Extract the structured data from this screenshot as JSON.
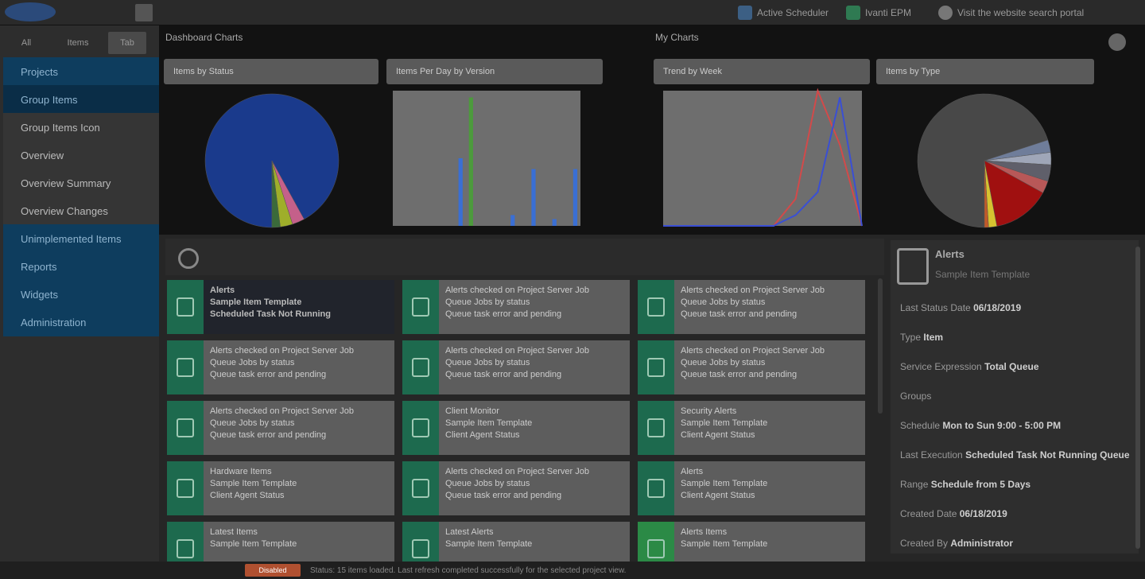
{
  "topbar": {
    "links": [
      {
        "label": "Active Scheduler",
        "icon": "calendar-icon"
      },
      {
        "label": "Ivanti EPM",
        "icon": "app-icon"
      },
      {
        "label": "Visit the website search portal",
        "icon": "user-icon"
      }
    ]
  },
  "left": {
    "tabs": [
      "All",
      "Items",
      "Tab"
    ],
    "nav": [
      {
        "label": "Projects",
        "style": "blue"
      },
      {
        "label": "Group Items",
        "style": "active"
      },
      {
        "label": "Group Items Icon",
        "style": "grey"
      },
      {
        "label": "Overview",
        "style": "grey"
      },
      {
        "label": "Overview Summary",
        "style": "grey"
      },
      {
        "label": "Overview Changes",
        "style": "grey"
      },
      {
        "label": "Unimplemented Items",
        "style": "blue"
      },
      {
        "label": "Reports",
        "style": "blue"
      },
      {
        "label": "Widgets",
        "style": "blue"
      },
      {
        "label": "Administration",
        "style": "blue"
      }
    ]
  },
  "strip": {
    "left_title": "Dashboard Charts",
    "right_title": "My Charts",
    "chart_heads": [
      "Items by Status",
      "Items Per Day by Version",
      "Trend by Week",
      "Items by Type"
    ]
  },
  "cards": [
    {
      "lines": [
        "Alerts",
        "Sample Item Template",
        "Scheduled Task Not Running"
      ],
      "selected": true
    },
    {
      "lines": [
        "Alerts checked on Project Server Job",
        "Queue Jobs by status",
        "Queue task error and pending"
      ]
    },
    {
      "lines": [
        "Alerts checked on Project Server Job",
        "Queue Jobs by status",
        "Queue task error and pending"
      ]
    },
    {
      "lines": [
        "Alerts checked on Project Server Job",
        "Queue Jobs by status",
        "Queue task error and pending"
      ]
    },
    {
      "lines": [
        "Alerts checked on Project Server Job",
        "Queue Jobs by status",
        "Queue task error and pending"
      ]
    },
    {
      "lines": [
        "Alerts checked on Project Server Job",
        "Queue Jobs by status",
        "Queue task error and pending"
      ]
    },
    {
      "lines": [
        "Alerts checked on Project Server Job",
        "Queue Jobs by status",
        "Queue task error and pending"
      ]
    },
    {
      "lines": [
        "Client Monitor",
        "Sample Item Template",
        "Client Agent Status"
      ]
    },
    {
      "lines": [
        "Security Alerts",
        "Sample Item Template",
        "Client Agent Status"
      ]
    },
    {
      "lines": [
        "Hardware Items",
        "Sample Item Template",
        "Client Agent Status"
      ]
    },
    {
      "lines": [
        "Alerts checked on Project Server Job",
        "Queue Jobs by status",
        "Queue task error and pending"
      ]
    },
    {
      "lines": [
        "Alerts",
        "Sample Item Template",
        "Client Agent Status"
      ]
    },
    {
      "lines": [
        "Latest Items",
        "Sample Item Template"
      ]
    },
    {
      "lines": [
        "Latest Alerts",
        "Sample Item Template"
      ]
    },
    {
      "lines": [
        "Alerts Items",
        "Sample Item Template"
      ],
      "bright": true
    }
  ],
  "details": {
    "title": "Alerts",
    "subtitle": "Sample Item Template",
    "props": [
      {
        "k": "Last Status Date",
        "v": "06/18/2019"
      },
      {
        "k": "Type",
        "v": "Item"
      },
      {
        "k": "Service Expression",
        "v": "Total Queue"
      },
      {
        "k": "Groups",
        "v": ""
      },
      {
        "k": "Schedule",
        "v": "Mon to Sun 9:00 - 5:00 PM"
      },
      {
        "k": "Last Execution",
        "v": "Scheduled Task Not Running Queue"
      },
      {
        "k": "Range",
        "v": "Schedule from 5 Days"
      },
      {
        "k": "Created Date",
        "v": "06/18/2019"
      },
      {
        "k": "Created By",
        "v": "Administrator"
      }
    ]
  },
  "status": {
    "badge": "Disabled",
    "text": "Status: 15 items loaded. Last refresh completed successfully for the selected project view."
  },
  "chart_data": [
    {
      "type": "pie",
      "title": "Items by Status",
      "values": [
        92,
        3,
        3,
        2
      ],
      "colors": [
        "#1a3a8c",
        "#c4608a",
        "#9fae2a",
        "#3a6a3a"
      ]
    },
    {
      "type": "bar",
      "title": "Items Per Day by Version",
      "categories": [
        "1",
        "2",
        "3",
        "4",
        "5",
        "6",
        "7",
        "8",
        "9",
        "10",
        "11",
        "12",
        "13",
        "14",
        "15",
        "16",
        "17",
        "18"
      ],
      "series": [
        {
          "values": [
            0,
            0,
            0,
            0,
            0,
            0,
            50,
            0,
            0,
            0,
            0,
            0,
            0,
            0,
            0,
            0,
            0,
            0
          ],
          "color": "#3a6fd4"
        },
        {
          "values": [
            0,
            0,
            0,
            0,
            0,
            0,
            0,
            95,
            0,
            0,
            0,
            0,
            0,
            0,
            0,
            0,
            0,
            0
          ],
          "color": "#4c9a3c"
        },
        {
          "values": [
            0,
            0,
            0,
            0,
            0,
            0,
            0,
            0,
            0,
            0,
            0,
            8,
            0,
            42,
            0,
            5,
            0,
            42
          ],
          "color": "#3a6fd4"
        }
      ],
      "ylim": [
        0,
        100
      ]
    },
    {
      "type": "line",
      "title": "Trend by Week",
      "x": [
        1,
        2,
        3,
        4,
        5,
        6,
        7,
        8,
        9,
        10
      ],
      "ylim": [
        0,
        100
      ],
      "series": [
        {
          "values": [
            0,
            0,
            0,
            0,
            0,
            0,
            20,
            100,
            60,
            0
          ],
          "color": "#d24a4a"
        },
        {
          "values": [
            0,
            0,
            0,
            0,
            0,
            0,
            8,
            25,
            95,
            0
          ],
          "color": "#3a4fd4"
        }
      ]
    },
    {
      "type": "pie",
      "title": "Items by Type",
      "values": [
        70,
        3,
        3,
        4,
        3,
        14,
        2,
        1
      ],
      "colors": [
        "#484848",
        "#6f7d9a",
        "#9fa6b8",
        "#5f5f6a",
        "#b85858",
        "#a01010",
        "#d6c230",
        "#c05a2a"
      ]
    }
  ]
}
